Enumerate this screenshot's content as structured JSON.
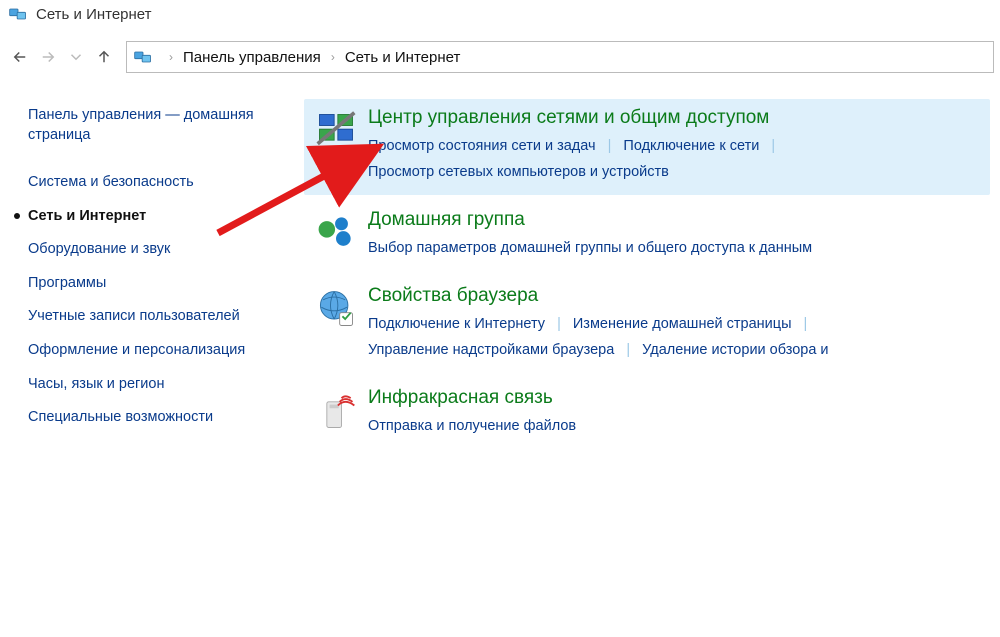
{
  "window_title": "Сеть и Интернет",
  "breadcrumb": {
    "root": "Панель управления",
    "current": "Сеть и Интернет"
  },
  "sidebar": {
    "home": "Панель управления — домашняя страница",
    "items": [
      "Система и безопасность",
      "Сеть и Интернет",
      "Оборудование и звук",
      "Программы",
      "Учетные записи пользователей",
      "Оформление и персонализация",
      "Часы, язык и регион",
      "Специальные возможности"
    ]
  },
  "categories": [
    {
      "title": "Центр управления сетями и общим доступом",
      "links": [
        "Просмотр состояния сети и задач",
        "Подключение к сети",
        "Просмотр сетевых компьютеров и устройств"
      ]
    },
    {
      "title": "Домашняя группа",
      "links": [
        "Выбор параметров домашней группы и общего доступа к данным"
      ]
    },
    {
      "title": "Свойства браузера",
      "links": [
        "Подключение к Интернету",
        "Изменение домашней страницы",
        "Управление надстройками браузера",
        "Удаление истории обзора и"
      ]
    },
    {
      "title": "Инфракрасная связь",
      "links": [
        "Отправка и получение файлов"
      ]
    }
  ]
}
